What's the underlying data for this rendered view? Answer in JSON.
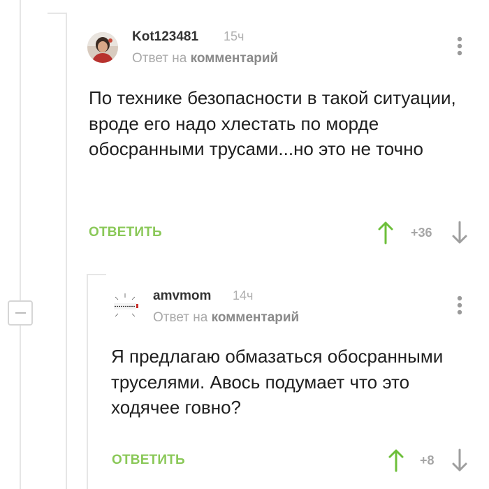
{
  "comments": [
    {
      "author": "Kot123481",
      "time": "15ч",
      "reply_prefix": "Ответ на",
      "reply_target": "комментарий",
      "text": "По технике безопасности в такой ситуации, вроде его надо хлестать по морде обосранными трусами...но это не точно",
      "reply_label": "ОТВЕТИТЬ",
      "score": "+36"
    },
    {
      "author": "amvmom",
      "time": "14ч",
      "reply_prefix": "Ответ на",
      "reply_target": "комментарий",
      "text": "Я предлагаю обмазаться обосранными труселями. Авось подумает что это ходячее говно?",
      "reply_label": "ОТВЕТИТЬ",
      "score": "+8"
    }
  ],
  "colors": {
    "accent_green": "#8ac858",
    "vote_up": "#6dbf3a",
    "vote_down": "#9e9e9e"
  }
}
